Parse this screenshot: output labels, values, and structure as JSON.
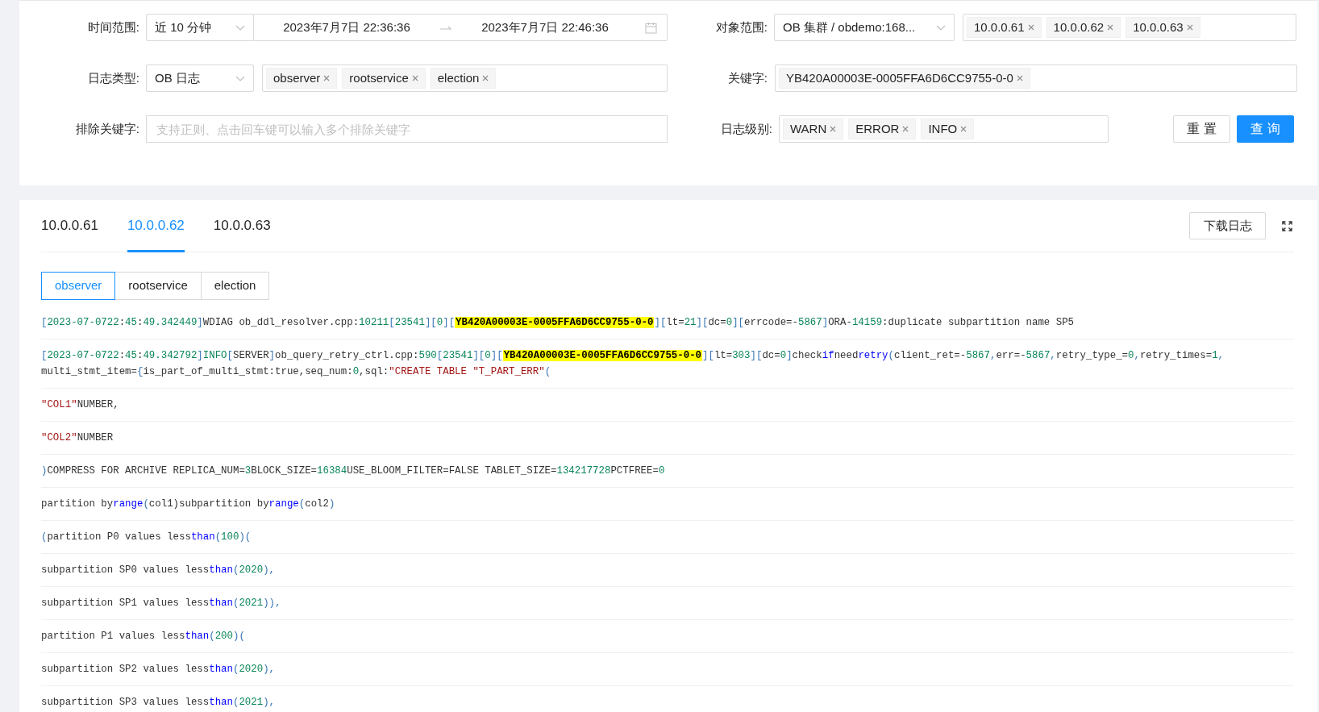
{
  "filters": {
    "time_range": {
      "label": "时间范围:",
      "preset": "近 10 分钟",
      "start": "2023年7月7日 22:36:36",
      "end": "2023年7月7日 22:46:36"
    },
    "object_scope": {
      "label": "对象范围:",
      "value": "OB 集群 / obdemo:168...",
      "tags": [
        "10.0.0.61",
        "10.0.0.62",
        "10.0.0.63"
      ]
    },
    "log_type": {
      "label": "日志类型:",
      "value": "OB 日志",
      "tags": [
        "observer",
        "rootservice",
        "election"
      ]
    },
    "keyword": {
      "label": "关键字:",
      "tags": [
        "YB420A00003E-0005FFA6D6CC9755-0-0"
      ]
    },
    "exclude_keyword": {
      "label": "排除关键字:",
      "placeholder": "支持正则、点击回车键可以输入多个排除关键字"
    },
    "log_level": {
      "label": "日志级别:",
      "tags": [
        "WARN",
        "ERROR",
        "INFO"
      ]
    },
    "buttons": [
      {
        "label": "重 置",
        "kind": "default"
      },
      {
        "label": "查 询",
        "kind": "primary"
      }
    ]
  },
  "server_tabs": [
    {
      "label": "10.0.0.61",
      "selected": false
    },
    {
      "label": "10.0.0.62",
      "selected": true
    },
    {
      "label": "10.0.0.63",
      "selected": false
    }
  ],
  "download_button": "下载日志",
  "log_tabs": [
    {
      "label": "observer",
      "selected": true
    },
    {
      "label": "rootservice",
      "selected": false
    },
    {
      "label": "election",
      "selected": false
    }
  ],
  "log_lines": [
    {
      "segments": [
        {
          "kind": "bracket",
          "text": "["
        },
        {
          "kind": "number",
          "text": "2023-07-0722"
        },
        {
          "kind": "text",
          "text": ":"
        },
        {
          "kind": "number",
          "text": "45"
        },
        {
          "kind": "text",
          "text": ":"
        },
        {
          "kind": "number",
          "text": "49.342449"
        },
        {
          "kind": "bracket",
          "text": "]"
        },
        {
          "kind": "text",
          "text": "WDIAG ob_ddl_resolver.cpp:"
        },
        {
          "kind": "number",
          "text": "10211"
        },
        {
          "kind": "bracket",
          "text": "["
        },
        {
          "kind": "number",
          "text": "23541"
        },
        {
          "kind": "bracket",
          "text": "]["
        },
        {
          "kind": "number",
          "text": "0"
        },
        {
          "kind": "bracket",
          "text": "]["
        },
        {
          "kind": "match",
          "text": "YB420A00003E-0005FFA6D6CC9755-0-0"
        },
        {
          "kind": "bracket",
          "text": "]["
        },
        {
          "kind": "text",
          "text": "lt="
        },
        {
          "kind": "number",
          "text": "21"
        },
        {
          "kind": "bracket",
          "text": "]["
        },
        {
          "kind": "text",
          "text": "dc="
        },
        {
          "kind": "number",
          "text": "0"
        },
        {
          "kind": "bracket",
          "text": "]["
        },
        {
          "kind": "text",
          "text": "errcode=-"
        },
        {
          "kind": "number",
          "text": "5867"
        },
        {
          "kind": "bracket",
          "text": "]"
        },
        {
          "kind": "text",
          "text": "ORA-"
        },
        {
          "kind": "number",
          "text": "14159"
        },
        {
          "kind": "text",
          "text": ":duplicate subpartition name SP5"
        }
      ]
    },
    {
      "segments": [
        {
          "kind": "bracket",
          "text": "["
        },
        {
          "kind": "number",
          "text": "2023-07-0722"
        },
        {
          "kind": "text",
          "text": ":"
        },
        {
          "kind": "number",
          "text": "45"
        },
        {
          "kind": "text",
          "text": ":"
        },
        {
          "kind": "number",
          "text": "49.342792"
        },
        {
          "kind": "bracket",
          "text": "]"
        },
        {
          "kind": "number",
          "text": "INFO"
        },
        {
          "kind": "bracket",
          "text": "["
        },
        {
          "kind": "text",
          "text": "SERVER"
        },
        {
          "kind": "bracket",
          "text": "]"
        },
        {
          "kind": "text",
          "text": "ob_query_retry_ctrl.cpp:"
        },
        {
          "kind": "number",
          "text": "590"
        },
        {
          "kind": "bracket",
          "text": "["
        },
        {
          "kind": "number",
          "text": "23541"
        },
        {
          "kind": "bracket",
          "text": "]["
        },
        {
          "kind": "number",
          "text": "0"
        },
        {
          "kind": "bracket",
          "text": "]["
        },
        {
          "kind": "match",
          "text": "YB420A00003E-0005FFA6D6CC9755-0-0"
        },
        {
          "kind": "bracket",
          "text": "]["
        },
        {
          "kind": "text",
          "text": "lt="
        },
        {
          "kind": "number",
          "text": "303"
        },
        {
          "kind": "bracket",
          "text": "]["
        },
        {
          "kind": "text",
          "text": "dc="
        },
        {
          "kind": "number",
          "text": "0"
        },
        {
          "kind": "bracket",
          "text": "]"
        },
        {
          "kind": "text",
          "text": "check"
        },
        {
          "kind": "keyword",
          "text": "if"
        },
        {
          "kind": "text",
          "text": "need"
        },
        {
          "kind": "keyword",
          "text": "retry"
        },
        {
          "kind": "bracket",
          "text": "("
        },
        {
          "kind": "text",
          "text": "client_ret=-"
        },
        {
          "kind": "number",
          "text": "5867"
        },
        {
          "kind": "bracket",
          "text": ","
        },
        {
          "kind": "text",
          "text": "err=-"
        },
        {
          "kind": "number",
          "text": "5867"
        },
        {
          "kind": "bracket",
          "text": ","
        },
        {
          "kind": "text",
          "text": "retry_type_="
        },
        {
          "kind": "number",
          "text": "0"
        },
        {
          "kind": "bracket",
          "text": ","
        },
        {
          "kind": "text",
          "text": "retry_times="
        },
        {
          "kind": "number",
          "text": "1"
        },
        {
          "kind": "bracket",
          "text": ",\n"
        },
        {
          "kind": "text",
          "text": "multi_stmt_item="
        },
        {
          "kind": "bracket",
          "text": "{"
        },
        {
          "kind": "text",
          "text": "is_part_of_multi_stmt:true,seq_num:"
        },
        {
          "kind": "number",
          "text": "0"
        },
        {
          "kind": "text",
          "text": ",sql:"
        },
        {
          "kind": "string",
          "text": "\"CREATE TABLE \"T_PART_ERR\""
        },
        {
          "kind": "bracket",
          "text": "("
        }
      ]
    },
    {
      "segments": [
        {
          "kind": "string",
          "text": "\"COL1\""
        },
        {
          "kind": "text",
          "text": "NUMBER,"
        }
      ]
    },
    {
      "segments": [
        {
          "kind": "string",
          "text": "\"COL2\""
        },
        {
          "kind": "text",
          "text": "NUMBER"
        }
      ]
    },
    {
      "segments": [
        {
          "kind": "bracket",
          "text": ")"
        },
        {
          "kind": "text",
          "text": "COMPRESS FOR ARCHIVE REPLICA_NUM="
        },
        {
          "kind": "number",
          "text": "3"
        },
        {
          "kind": "text",
          "text": "BLOCK_SIZE="
        },
        {
          "kind": "number",
          "text": "16384"
        },
        {
          "kind": "text",
          "text": "USE_BLOOM_FILTER=FALSE TABLET_SIZE="
        },
        {
          "kind": "number",
          "text": "134217728"
        },
        {
          "kind": "text",
          "text": "PCTFREE="
        },
        {
          "kind": "number",
          "text": "0"
        }
      ]
    },
    {
      "segments": [
        {
          "kind": "text",
          "text": "partition by"
        },
        {
          "kind": "keyword",
          "text": "range"
        },
        {
          "kind": "bracket",
          "text": "("
        },
        {
          "kind": "text",
          "text": "col1)subpartition by"
        },
        {
          "kind": "keyword",
          "text": "range"
        },
        {
          "kind": "bracket",
          "text": "("
        },
        {
          "kind": "text",
          "text": "col2"
        },
        {
          "kind": "bracket",
          "text": ")"
        }
      ]
    },
    {
      "segments": [
        {
          "kind": "bracket",
          "text": "("
        },
        {
          "kind": "text",
          "text": "partition P0 values less"
        },
        {
          "kind": "keyword",
          "text": "than"
        },
        {
          "kind": "bracket",
          "text": "("
        },
        {
          "kind": "number",
          "text": "100"
        },
        {
          "kind": "bracket",
          "text": ")("
        }
      ]
    },
    {
      "segments": [
        {
          "kind": "text",
          "text": "subpartition SP0 values less"
        },
        {
          "kind": "keyword",
          "text": "than"
        },
        {
          "kind": "bracket",
          "text": "("
        },
        {
          "kind": "number",
          "text": "2020"
        },
        {
          "kind": "bracket",
          "text": "),"
        }
      ]
    },
    {
      "segments": [
        {
          "kind": "text",
          "text": "subpartition SP1 values less"
        },
        {
          "kind": "keyword",
          "text": "than"
        },
        {
          "kind": "bracket",
          "text": "("
        },
        {
          "kind": "number",
          "text": "2021"
        },
        {
          "kind": "bracket",
          "text": ")),"
        }
      ]
    },
    {
      "segments": [
        {
          "kind": "text",
          "text": "partition P1 values less"
        },
        {
          "kind": "keyword",
          "text": "than"
        },
        {
          "kind": "bracket",
          "text": "("
        },
        {
          "kind": "number",
          "text": "200"
        },
        {
          "kind": "bracket",
          "text": ")("
        }
      ]
    },
    {
      "segments": [
        {
          "kind": "text",
          "text": "subpartition SP2 values less"
        },
        {
          "kind": "keyword",
          "text": "than"
        },
        {
          "kind": "bracket",
          "text": "("
        },
        {
          "kind": "number",
          "text": "2020"
        },
        {
          "kind": "bracket",
          "text": "),"
        }
      ]
    },
    {
      "segments": [
        {
          "kind": "text",
          "text": "subpartition SP3 values less"
        },
        {
          "kind": "keyword",
          "text": "than"
        },
        {
          "kind": "bracket",
          "text": "("
        },
        {
          "kind": "number",
          "text": "2021"
        },
        {
          "kind": "bracket",
          "text": "),"
        }
      ]
    }
  ]
}
